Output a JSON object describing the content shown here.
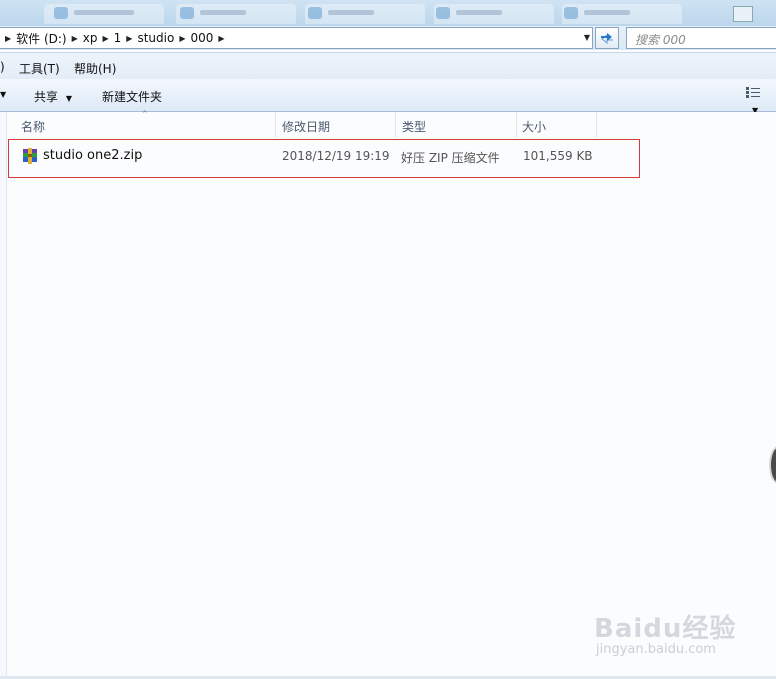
{
  "address": {
    "crumbs": [
      "软件 (D:)",
      "xp",
      "1",
      "studio",
      "000"
    ]
  },
  "search": {
    "placeholder": "搜索 000"
  },
  "menu": {
    "tools": "工具(T)",
    "help": "帮助(H)",
    "partial_paren": ")"
  },
  "toolbar": {
    "share": "共享",
    "new_folder": "新建文件夹"
  },
  "columns": {
    "name": "名称",
    "modified": "修改日期",
    "type": "类型",
    "size": "大小"
  },
  "files": [
    {
      "name": "studio one2.zip",
      "modified": "2018/12/19 19:19",
      "type": "好压 ZIP 压缩文件",
      "size": "101,559 KB"
    }
  ],
  "watermark": {
    "brand": "Baidu经验",
    "url": "jingyan.baidu.com"
  },
  "colors": {
    "highlight_border": "#d63b3b",
    "toolbar_bg": "#dde9f6"
  },
  "icons": [
    "zip-archive-icon",
    "refresh-icon",
    "view-toggle-icon",
    "dropdown-arrow-icon"
  ]
}
